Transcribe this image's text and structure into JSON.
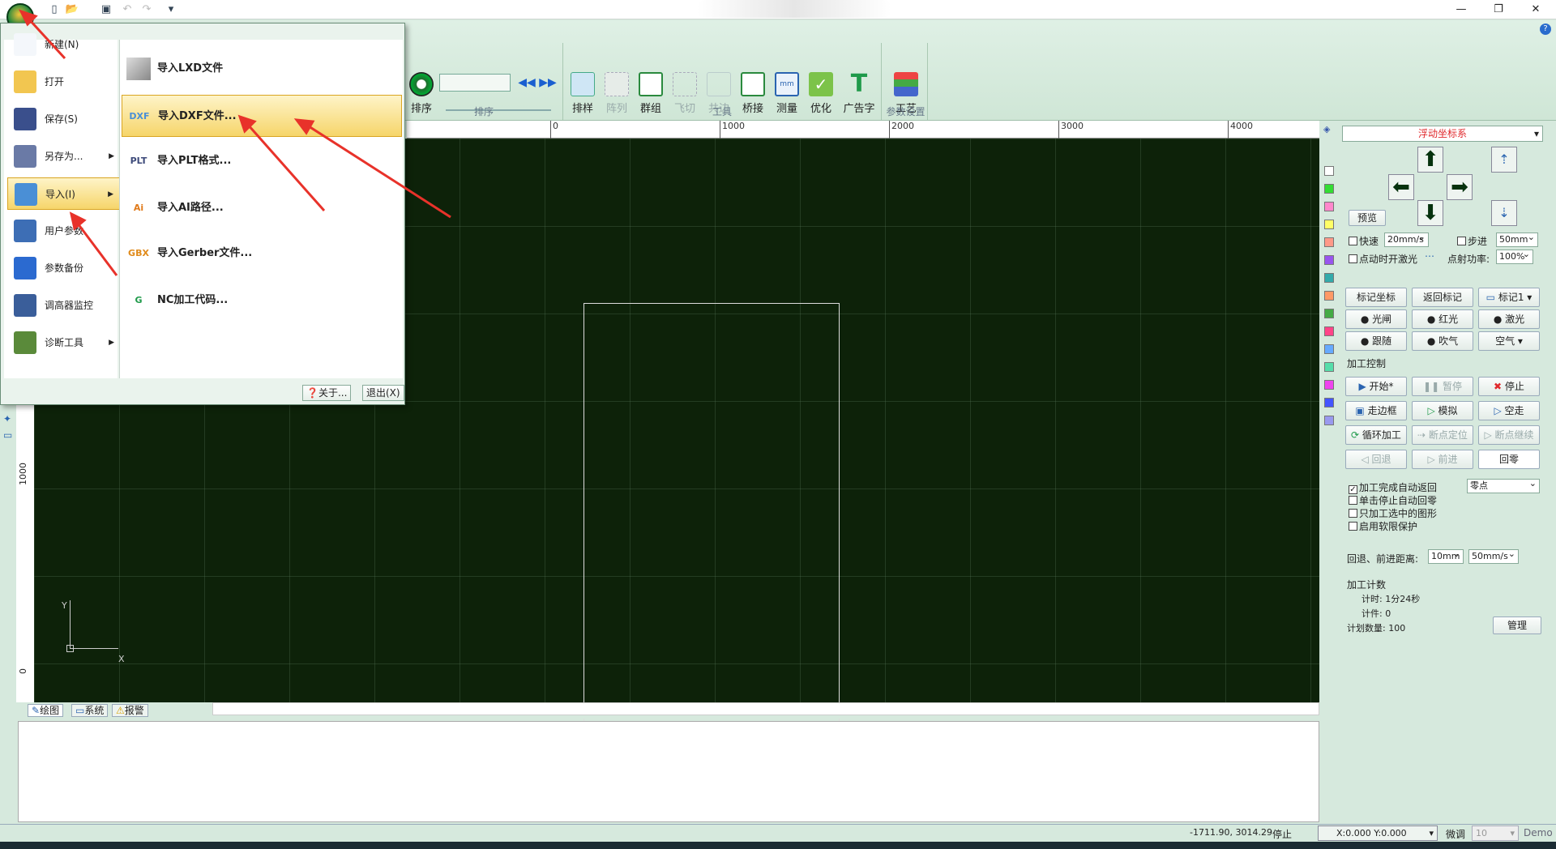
{
  "ribbon": {
    "group_sort_label": "排序",
    "group_tools_label": "工具",
    "group_params_label": "参数设置",
    "buttons": {
      "sort": "排序",
      "layout": "排样",
      "array": "阵列",
      "group": "群组",
      "flycut": "飞切",
      "common_edge": "共边",
      "bridge": "桥接",
      "measure": "测量",
      "optimize": "优化",
      "ad_text": "广告字",
      "process": "工艺"
    }
  },
  "app_menu": {
    "left_items": [
      {
        "label": "新建(N)",
        "icon": "new-file-icon"
      },
      {
        "label": "打开",
        "icon": "open-folder-icon"
      },
      {
        "label": "保存(S)",
        "icon": "save-disk-icon"
      },
      {
        "label": "另存为...",
        "icon": "save-as-icon"
      },
      {
        "label": "导入(I)",
        "icon": "import-icon"
      },
      {
        "label": "用户参数",
        "icon": "user-params-icon"
      },
      {
        "label": "参数备份",
        "icon": "backup-gear-icon"
      },
      {
        "label": "调高器监控",
        "icon": "monitor-icon"
      },
      {
        "label": "诊断工具",
        "icon": "diagnose-icon"
      }
    ],
    "import_items": [
      {
        "label": "导入LXD文件",
        "icon_text": ""
      },
      {
        "label": "导入DXF文件...",
        "icon_text": "DXF"
      },
      {
        "label": "导入PLT格式...",
        "icon_text": "PLT"
      },
      {
        "label": "导入AI路径...",
        "icon_text": "Ai"
      },
      {
        "label": "导入Gerber文件...",
        "icon_text": "GBX"
      },
      {
        "label": "NC加工代码...",
        "icon_text": "G"
      }
    ],
    "about": "关于...",
    "exit": "退出(X)"
  },
  "ruler": {
    "h_ticks": [
      "0",
      "1000",
      "2000",
      "3000",
      "4000"
    ],
    "v_ticks": [
      "1000",
      "0"
    ]
  },
  "axes": {
    "y": "Y",
    "x": "X"
  },
  "panel": {
    "coord_mode": "浮动坐标系",
    "preview": "预览",
    "fast_label": "快速",
    "fast_speed": "20mm/s",
    "step_label": "步进",
    "step_value": "50mm",
    "pulse_laser": "点动时开激光",
    "point_power_label": "点射功率:",
    "point_power": "100%",
    "mark_coord": "标记坐标",
    "return_mark": "返回标记",
    "mark1": "标记1",
    "shutter": "光闸",
    "red_light": "红光",
    "laser": "激光",
    "follow": "跟随",
    "blow": "吹气",
    "air": "空气",
    "process_control": "加工控制",
    "start": "开始*",
    "pause": "暂停",
    "stop": "停止",
    "frame": "走边框",
    "simulate": "模拟",
    "dry_run": "空走",
    "loop": "循环加工",
    "bp_locate": "断点定位",
    "bp_continue": "断点继续",
    "retreat": "回退",
    "advance": "前进",
    "home": "回零",
    "opt_auto_return": "加工完成自动返回",
    "opt_auto_return_checked": "✓",
    "return_target": "零点",
    "opt_stop_home": "单击停止自动回零",
    "opt_selected_only": "只加工选中的图形",
    "opt_soft_limit": "启用软限保护",
    "retreat_dist_label": "回退、前进距离:",
    "retreat_dist": "10mm",
    "retreat_speed": "50mm/s",
    "count_title": "加工计数",
    "time_label": "计时:",
    "time_value": "1分24秒",
    "pieces_label": "计件:",
    "pieces_value": "0",
    "plan_label": "计划数量:",
    "plan_value": "100",
    "manage": "管理"
  },
  "tabs": [
    "绘图",
    "系统",
    "报警"
  ],
  "status": {
    "coords": "-1711.90, 3014.29",
    "state": "停止",
    "xy": "X:0.000 Y:0.000",
    "fine_label": "微调",
    "fine_value": "10",
    "mode": "Demo"
  },
  "swatch_colors": [
    "#ffffff",
    "#33dd33",
    "#ff88cc",
    "#ffff66",
    "#ff9988",
    "#9955ee",
    "#33aaaa",
    "#ff9966",
    "#44aa44",
    "#ff4488",
    "#66aaff",
    "#55ddaa",
    "#ee44ee",
    "#4455ff",
    "#9999ee"
  ]
}
